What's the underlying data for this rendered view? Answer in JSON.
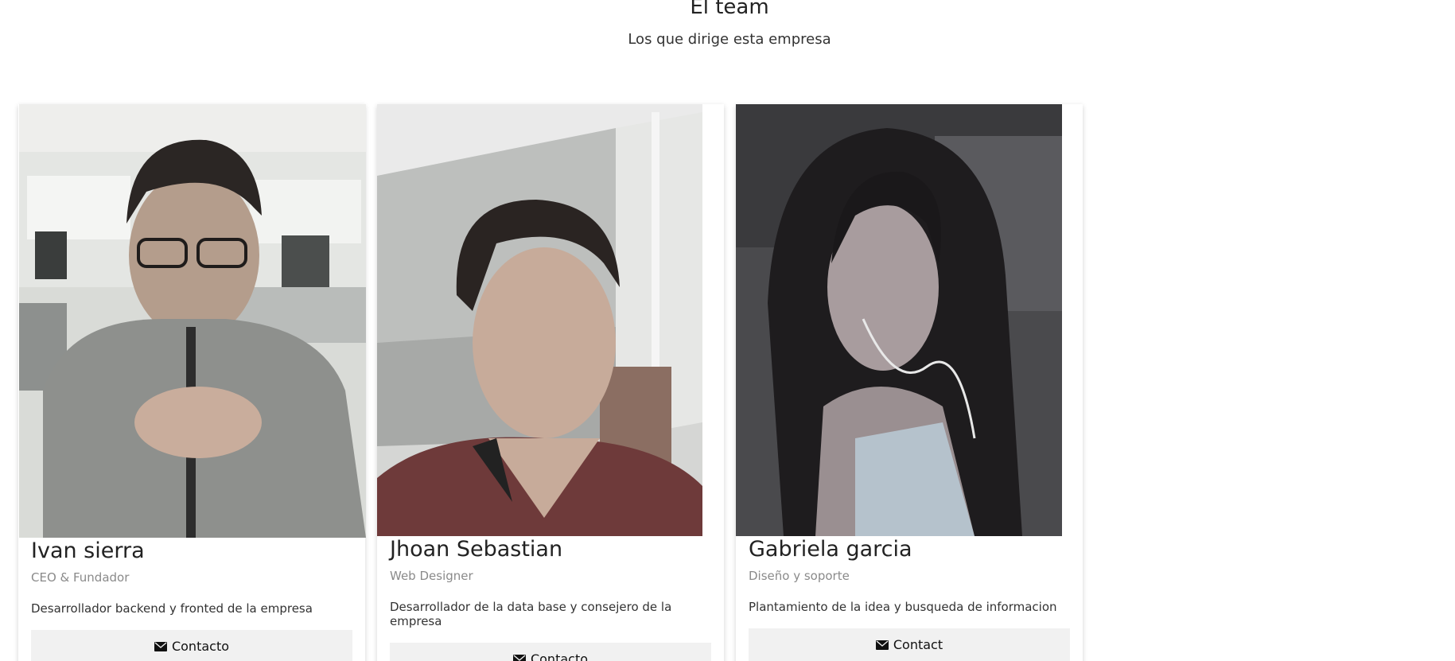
{
  "section": {
    "title": "El team",
    "subtitle": "Los que dirige esta empresa"
  },
  "team": [
    {
      "name": "Ivan sierra",
      "role": "CEO & Fundador",
      "description": "Desarrollador backend y fronted de la empresa",
      "button_label": "Contacto",
      "button_icon": "envelope-icon"
    },
    {
      "name": "Jhoan Sebastian",
      "role": "Web Designer",
      "description": "Desarrollador de la data base y consejero de la empresa",
      "button_label": "Contacto",
      "button_icon": "envelope-icon"
    },
    {
      "name": "Gabriela garcia",
      "role": "Diseño y soporte",
      "description": "Plantamiento de la idea y busqueda de informacion",
      "button_label": "Contact",
      "button_icon": "envelope-icon"
    }
  ],
  "colors": {
    "card_shadow": "#cccccc",
    "button_bg": "#f1f1f1",
    "role_text": "#8a8a8a"
  }
}
